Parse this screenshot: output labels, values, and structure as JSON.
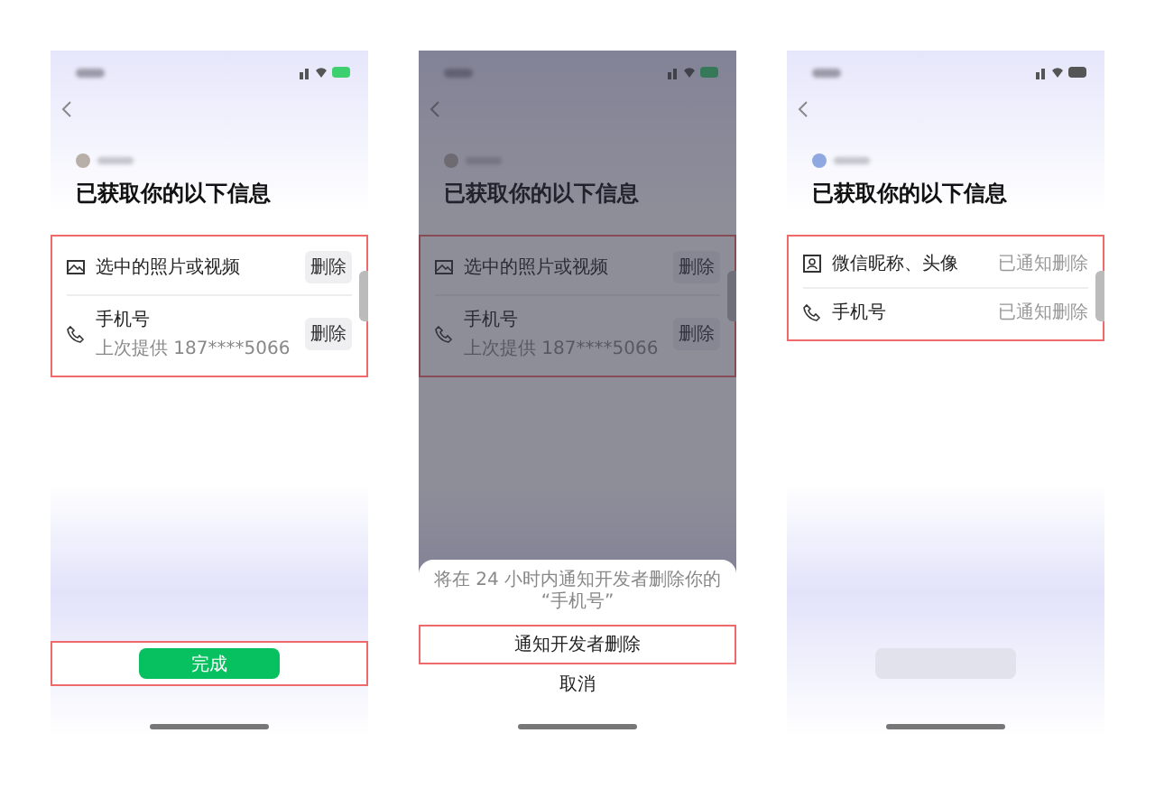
{
  "phones": [
    {
      "dimmed": false,
      "heading": "已获取你的以下信息",
      "list_highlighted": true,
      "items": [
        {
          "kind": "photo",
          "title": "选中的照片或视频",
          "action": {
            "kind": "button",
            "label": "删除"
          }
        },
        {
          "kind": "phone",
          "title": "手机号",
          "subtitle": "上次提供 187****5066",
          "action": {
            "kind": "button",
            "label": "删除"
          }
        }
      ],
      "footer": {
        "kind": "primary",
        "label": "完成",
        "highlighted": true
      }
    },
    {
      "dimmed": true,
      "heading": "已获取你的以下信息",
      "list_highlighted": true,
      "items": [
        {
          "kind": "photo",
          "title": "选中的照片或视频",
          "action": {
            "kind": "button",
            "label": "删除"
          }
        },
        {
          "kind": "phone",
          "title": "手机号",
          "subtitle": "上次提供 187****5066",
          "action": {
            "kind": "button",
            "label": "删除"
          }
        }
      ],
      "sheet": {
        "message": "将在 24 小时内通知开发者删除你的 “手机号”",
        "confirm": "通知开发者删除",
        "confirm_highlighted": true,
        "cancel": "取消"
      }
    },
    {
      "dimmed": false,
      "heading": "已获取你的以下信息",
      "list_highlighted": true,
      "items": [
        {
          "kind": "profile",
          "title": "微信昵称、头像",
          "action": {
            "kind": "text",
            "label": "已通知删除"
          }
        },
        {
          "kind": "phone",
          "title": "手机号",
          "action": {
            "kind": "text",
            "label": "已通知删除"
          }
        }
      ],
      "footer": {
        "kind": "muted",
        "highlighted": false
      }
    }
  ]
}
